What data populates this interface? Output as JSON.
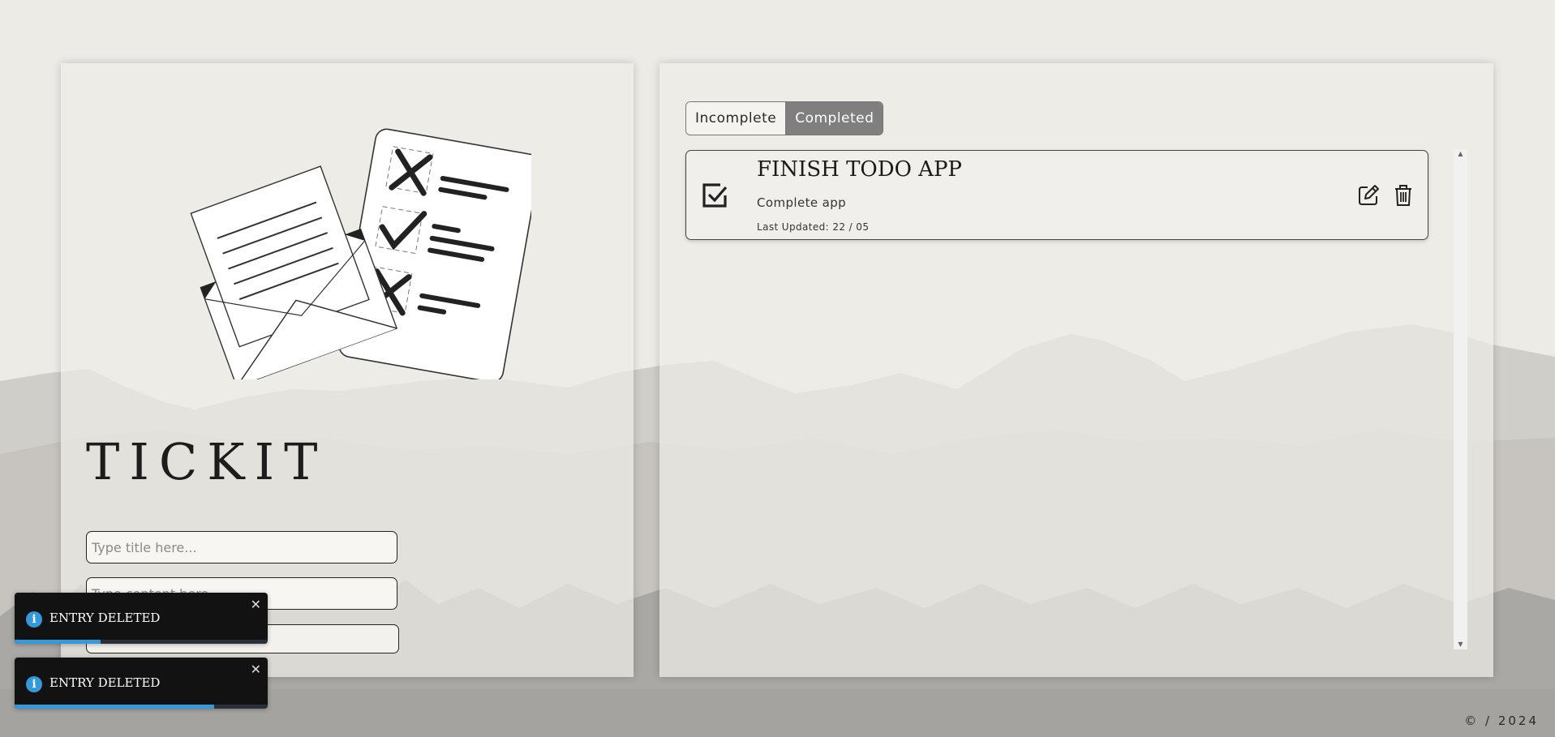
{
  "app": {
    "title": "TICKIT"
  },
  "form": {
    "title_placeholder": "Type title here...",
    "content_placeholder": "Type content here...",
    "submit_label": ""
  },
  "tabs": [
    {
      "label": "Incomplete",
      "active": false
    },
    {
      "label": "Completed",
      "active": true
    }
  ],
  "todos": [
    {
      "title": "FINISH TODO APP",
      "content": "Complete app",
      "last_updated": "Last Updated: 22 / 05",
      "completed": true
    }
  ],
  "toasts": [
    {
      "message": "ENTRY DELETED",
      "close": "✕",
      "progress": 0.34
    },
    {
      "message": "ENTRY DELETED",
      "close": "✕",
      "progress": 0.79
    }
  ],
  "footer": {
    "text": "© / 2024"
  },
  "colors": {
    "background": "#edebe6",
    "active_tab": "#7f7f7f",
    "toast_bg": "#121212",
    "toast_accent": "#3498db"
  },
  "icons": [
    "checkbox-checked-icon",
    "edit-icon",
    "trash-icon",
    "info-icon",
    "close-icon",
    "task-illustration"
  ]
}
